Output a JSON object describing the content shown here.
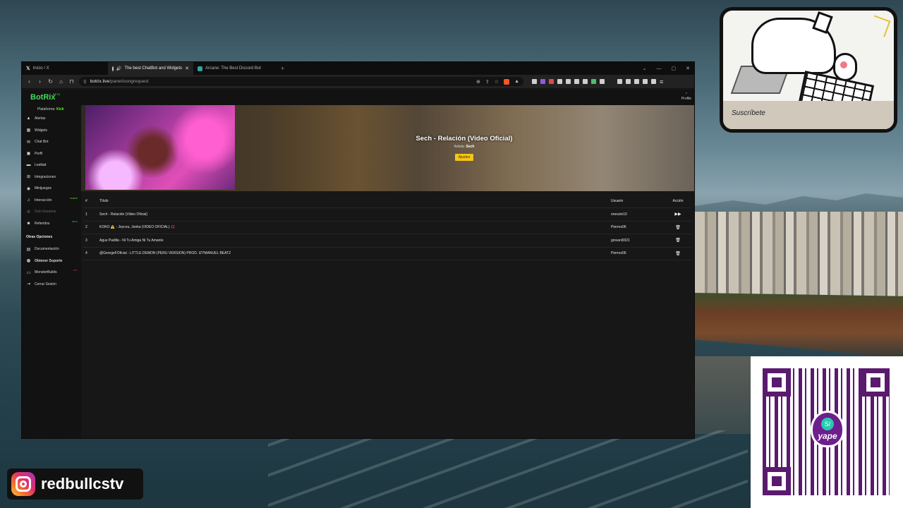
{
  "browser": {
    "tabs": [
      {
        "label": "Inicio / X",
        "icon": "x-logo-icon"
      },
      {
        "label": "The best ChatBot and Widgets",
        "icon": "botrix-icon",
        "active": true,
        "close": "✕"
      },
      {
        "label": "Arcane: The Best Discord Bot",
        "icon": "arcane-icon"
      }
    ],
    "new_tab": "+",
    "window_controls": [
      "⌄",
      "—",
      "▢",
      "✕"
    ],
    "url_host": "botrix.live",
    "url_path": "/panel/songrequest"
  },
  "app": {
    "logo": "BotRix",
    "logo_badge": "BETA",
    "profile_label": "Profile",
    "platform_label": "Plataforma:",
    "platform_value": "Kick",
    "nav": [
      {
        "label": "Alertas",
        "icon": "alert-icon",
        "glyph": "▲"
      },
      {
        "label": "Widgets",
        "icon": "widgets-icon",
        "glyph": "▦"
      },
      {
        "label": "Chat Bot",
        "icon": "chat-icon",
        "glyph": "✉"
      },
      {
        "label": "Perfil",
        "icon": "profile-icon",
        "glyph": "▣"
      },
      {
        "label": "Lealtad",
        "icon": "loyalty-icon",
        "glyph": "▬"
      },
      {
        "label": "Integraciones",
        "icon": "integrations-icon",
        "glyph": "⊞"
      },
      {
        "label": "Minijuegos",
        "icon": "games-icon",
        "glyph": "◉"
      },
      {
        "label": "Interacción",
        "icon": "music-icon",
        "glyph": "♫",
        "badge": "NUEVO"
      },
      {
        "label": "Sub-Usuarios",
        "icon": "sub-users-icon",
        "glyph": "⚙",
        "disabled": true
      },
      {
        "label": "Referidos",
        "icon": "referrals-icon",
        "glyph": "☻",
        "badge": "BETA"
      }
    ],
    "other_title": "Otras Opciones",
    "other": [
      {
        "label": "Documentación",
        "icon": "docs-icon",
        "glyph": "▤"
      },
      {
        "label": "Obtener Soporte",
        "icon": "support-icon",
        "glyph": "◍"
      },
      {
        "label": "MonsterBuilds",
        "icon": "monitor-icon",
        "glyph": "▭",
        "badge": "HOT"
      },
      {
        "label": "Cerrar Sesión",
        "icon": "logout-icon",
        "glyph": "⇥"
      }
    ]
  },
  "now_playing": {
    "title": "Sech - Relación (Video Oficial)",
    "artist_label": "Artista:",
    "artist": "Sech",
    "settings_button": "Ajustes"
  },
  "queue": {
    "headers": {
      "num": "#",
      "title": "Título",
      "user": "Usuario",
      "action": "Acción"
    },
    "rows": [
      {
        "num": "1",
        "title": "Sech - Relación (Video Oficial)",
        "user": "oneszin10",
        "action": "▶▶",
        "action_icon": "skip-icon"
      },
      {
        "num": "2",
        "title": "KOKO ⚠️ - Jeycou, Jonka (VIDEO OFICIAL) 💢",
        "user": "Pierroo06",
        "action": "🗑",
        "action_icon": "trash-icon"
      },
      {
        "num": "3",
        "title": "Agus Padilla - Ni Tu Amiga Ni Tu Amante",
        "user": "giovani9321",
        "action": "🗑",
        "action_icon": "trash-icon"
      },
      {
        "num": "4",
        "title": "@GeorgeFOficial - LITTLE DEMON (PERU VERSION) PROD. IZYMANUEL BEATZ",
        "user": "Pierroo06",
        "action": "🗑",
        "action_icon": "trash-icon"
      }
    ]
  },
  "overlays": {
    "cat_sign": "Suscríbete",
    "yape_symbol": "S/",
    "yape_word": "yape",
    "instagram_handle": "redbullcstv"
  }
}
